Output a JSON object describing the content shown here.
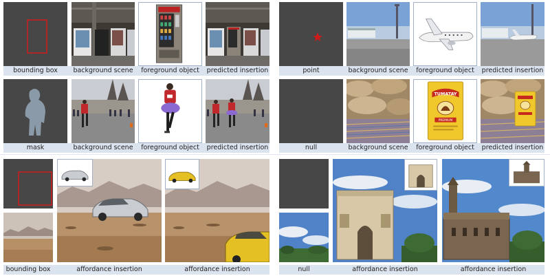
{
  "panels": {
    "tl": {
      "row1": [
        "bounding box",
        "background scene",
        "foreground object",
        "predicted insertion"
      ],
      "row2": [
        "mask",
        "background scene",
        "foreground object",
        "predicted insertion"
      ]
    },
    "tr": {
      "row1": [
        "point",
        "background scene",
        "foreground object",
        "predicted insertion"
      ],
      "row2": [
        "null",
        "background scene",
        "foreground object",
        "predicted insertion"
      ],
      "product_brand": "TUMATAY",
      "product_sub": "PREMIUM"
    },
    "bl": [
      "bounding box",
      "affordance insertion",
      "affordance insertion"
    ],
    "br": [
      "null",
      "affordance insertion",
      "affordance insertion"
    ]
  },
  "colors": {
    "caption_bg": "#dbe3ef",
    "condition_bg": "#474747",
    "condition_mark": "#d11b1b"
  }
}
